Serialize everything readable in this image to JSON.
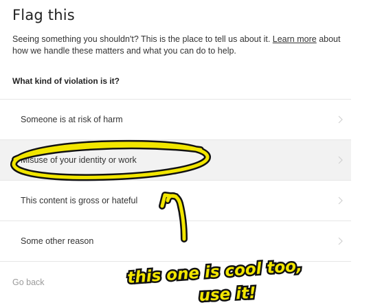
{
  "title": "Flag this",
  "intro": {
    "text": "Seeing something you shouldn't? This is the place to tell us about it. ",
    "link": "Learn more",
    "text_after": " about how we handle these matters and what you can do to help."
  },
  "question": "What kind of violation is it?",
  "options": [
    {
      "label": "Someone is at risk of harm",
      "icon": "chevron-right-icon"
    },
    {
      "label": "Misuse of your identity or work",
      "icon": "chevron-right-icon"
    },
    {
      "label": "This content is gross or hateful",
      "icon": "chevron-right-icon"
    },
    {
      "label": "Some other reason",
      "icon": "chevron-right-icon"
    }
  ],
  "back_label": "Go back",
  "annotation": {
    "line1": "this one is cool too,",
    "line2": "use it!"
  },
  "colors": {
    "highlight_yellow": "#f2e600",
    "outline": "#111111",
    "selected_row": "#f2f2f2",
    "divider": "#e6e6e6"
  }
}
